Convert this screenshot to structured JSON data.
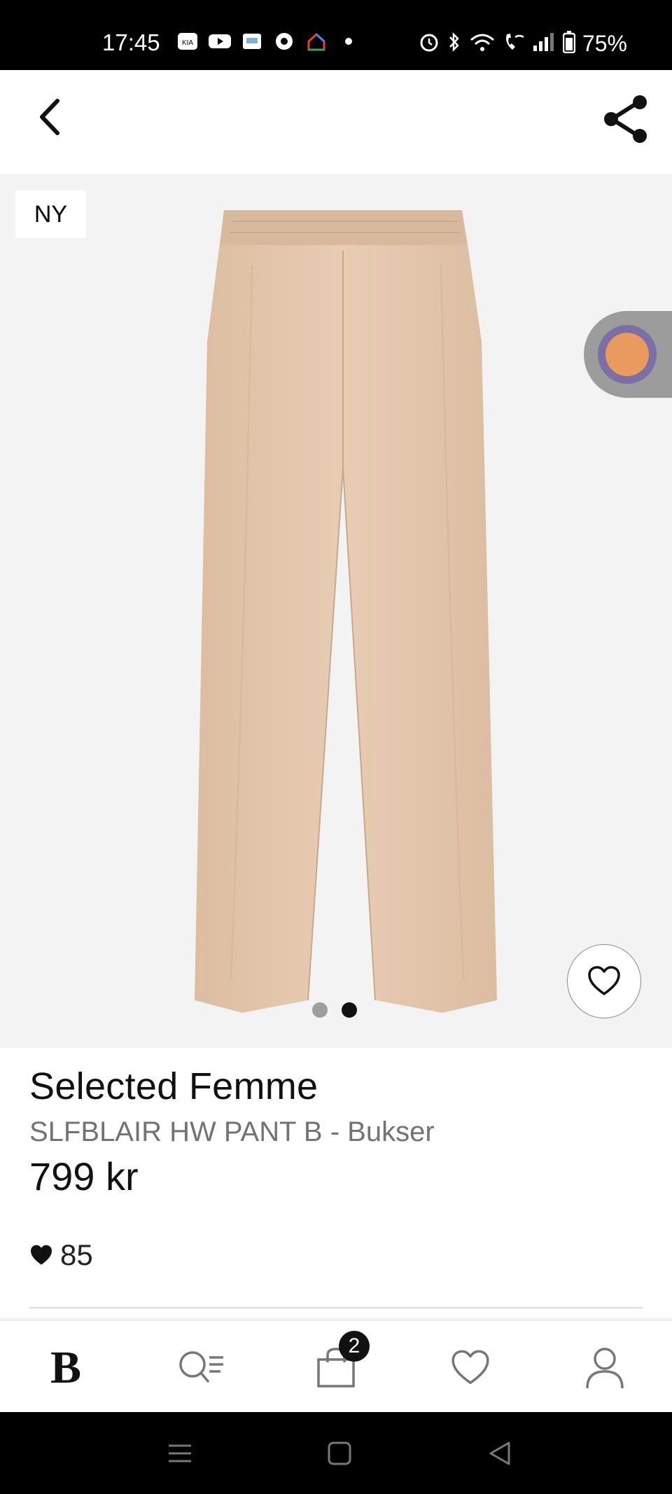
{
  "status_bar": {
    "time": "17:45",
    "battery": "75%",
    "notification_icons": [
      "kia-connect-icon",
      "youtube-icon",
      "app-icon",
      "chrome-like-icon",
      "google-home-icon",
      "dot-icon"
    ],
    "system_icons": [
      "alarm-icon",
      "bluetooth-icon",
      "wifi-icon",
      "wifi-call-icon",
      "signal-icon",
      "battery-icon"
    ]
  },
  "app_bar": {
    "back_icon": "chevron-left-icon",
    "share_icon": "share-icon"
  },
  "gallery": {
    "badge": "NY",
    "image_count": 2,
    "active_index": 2,
    "background": "#f3f3f3",
    "product_color": "#e4c6ab"
  },
  "product": {
    "brand": "Selected Femme",
    "name": "SLFBLAIR HW PANT B - Bukser",
    "price": "799 kr",
    "likes": "85"
  },
  "bottom_nav": {
    "logo": "B",
    "items": [
      "home-logo",
      "search-icon",
      "bag-icon",
      "heart-icon",
      "profile-icon"
    ],
    "cart_count": "2"
  },
  "colors": {
    "text_primary": "#111111",
    "text_secondary": "#737373",
    "divider": "#dcdcdc"
  }
}
